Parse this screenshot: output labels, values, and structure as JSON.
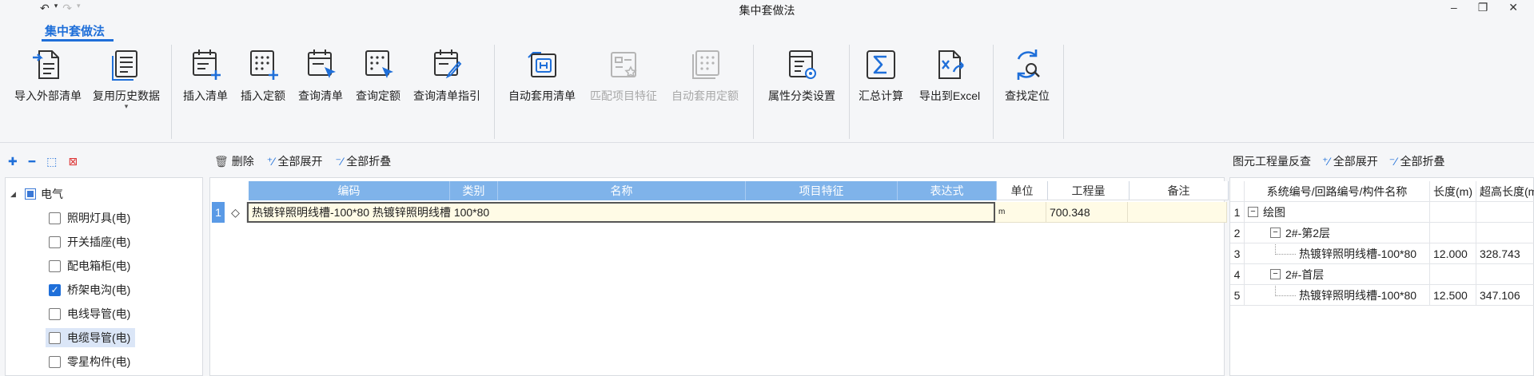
{
  "window": {
    "title": "集中套做法",
    "controls": {
      "minimize": "–",
      "restore": "❐",
      "close": "✕"
    }
  },
  "quick_access": {
    "undo": "↶",
    "redo": "↷"
  },
  "ribbon": {
    "tab": "集中套做法",
    "buttons": [
      {
        "id": "import-external",
        "label": "导入外部清单",
        "icon": "import-doc-icon",
        "enabled": true
      },
      {
        "id": "reuse-history",
        "label": "复用历史数据",
        "icon": "history-doc-icon",
        "enabled": true
      },
      {
        "id": "insert-list",
        "label": "插入清单",
        "icon": "calendar-plus-icon",
        "enabled": true
      },
      {
        "id": "insert-quota",
        "label": "插入定额",
        "icon": "grid-plus-icon",
        "enabled": true
      },
      {
        "id": "query-list",
        "label": "查询清单",
        "icon": "calendar-cursor-icon",
        "enabled": true
      },
      {
        "id": "query-quota",
        "label": "查询定额",
        "icon": "grid-cursor-icon",
        "enabled": true
      },
      {
        "id": "query-guide",
        "label": "查询清单指引",
        "icon": "calendar-pen-icon",
        "enabled": true
      },
      {
        "id": "auto-apply-list",
        "label": "自动套用清单",
        "icon": "auto-list-icon",
        "enabled": true
      },
      {
        "id": "match-feature",
        "label": "匹配项目特征",
        "icon": "match-feature-icon",
        "enabled": false
      },
      {
        "id": "auto-apply-quota",
        "label": "自动套用定额",
        "icon": "auto-quota-icon",
        "enabled": false
      },
      {
        "id": "attr-setting",
        "label": "属性分类设置",
        "icon": "attr-settings-icon",
        "enabled": true
      },
      {
        "id": "summary",
        "label": "汇总计算",
        "icon": "sigma-icon",
        "enabled": true
      },
      {
        "id": "export-excel",
        "label": "导出到Excel",
        "icon": "export-excel-icon",
        "enabled": true
      },
      {
        "id": "find-locate",
        "label": "查找定位",
        "icon": "find-locate-icon",
        "enabled": true
      }
    ]
  },
  "left_panel": {
    "tools": {
      "expand": "⁺⁄",
      "collapse": "⁻⁄",
      "select": "▢",
      "deselect": "▢"
    },
    "tree": {
      "root": "电气",
      "items": [
        {
          "label": "照明灯具(电)",
          "checked": false,
          "selected": false
        },
        {
          "label": "开关插座(电)",
          "checked": false,
          "selected": false
        },
        {
          "label": "配电箱柜(电)",
          "checked": false,
          "selected": false
        },
        {
          "label": "桥架电沟(电)",
          "checked": true,
          "selected": false
        },
        {
          "label": "电线导管(电)",
          "checked": false,
          "selected": false
        },
        {
          "label": "电缆导管(电)",
          "checked": false,
          "selected": true
        },
        {
          "label": "零星构件(电)",
          "checked": false,
          "selected": false
        }
      ]
    }
  },
  "center_panel": {
    "toolbar": {
      "delete": "删除",
      "expand_all": "全部展开",
      "collapse_all": "全部折叠"
    },
    "columns": {
      "code": "编码",
      "type": "类别",
      "name": "名称",
      "feature": "项目特征",
      "expression": "表达式",
      "unit": "单位",
      "quantity": "工程量",
      "remark": "备注"
    },
    "rows": [
      {
        "num": "1",
        "marker": "◇",
        "content": "热镀锌照明线槽-100*80 热镀锌照明线槽 100*80",
        "unit": "m",
        "quantity": "700.348",
        "remark": ""
      }
    ]
  },
  "right_panel": {
    "toolbar": {
      "title": "图元工程量反查",
      "expand_all": "全部展开",
      "collapse_all": "全部折叠"
    },
    "columns": {
      "name": "系统编号/回路编号/构件名称",
      "length": "长度(m)",
      "over_length": "超高长度(m)"
    },
    "rows": [
      {
        "num": "1",
        "name": "绘图",
        "length": "",
        "over": "",
        "level": 0,
        "toggle": "−"
      },
      {
        "num": "2",
        "name": "2#-第2层",
        "length": "",
        "over": "",
        "level": 1,
        "toggle": "−"
      },
      {
        "num": "3",
        "name": "热镀锌照明线槽-100*80",
        "length": "12.000",
        "over": "328.743",
        "level": 2,
        "toggle": ""
      },
      {
        "num": "4",
        "name": "2#-首层",
        "length": "",
        "over": "",
        "level": 1,
        "toggle": "−"
      },
      {
        "num": "5",
        "name": "热镀锌照明线槽-100*80",
        "length": "12.500",
        "over": "347.106",
        "level": 2,
        "toggle": ""
      }
    ]
  }
}
